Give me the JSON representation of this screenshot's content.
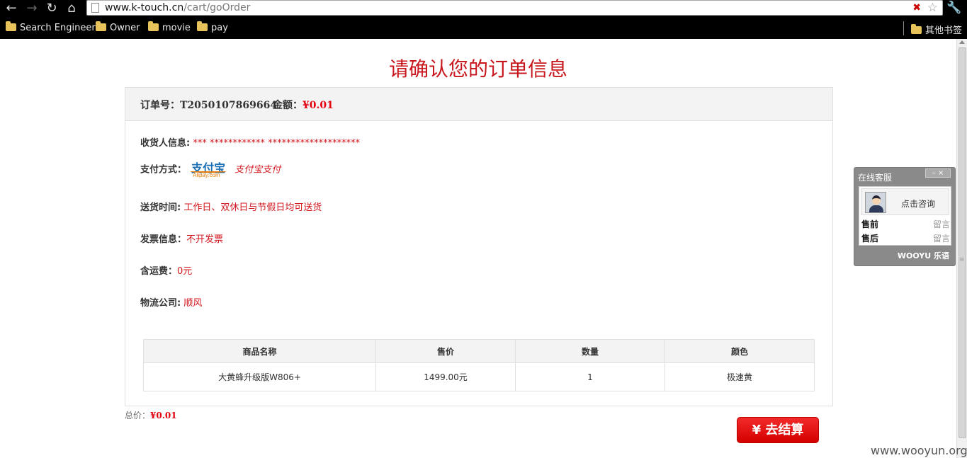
{
  "browser": {
    "url_host": "www.k-touch.cn",
    "url_path": "/cart/goOrder",
    "bookmarks": [
      "Search Engineer",
      "Owner",
      "movie",
      "pay"
    ],
    "other_bookmarks": "其他书签"
  },
  "page": {
    "title": "请确认您的订单信息",
    "order_no_label": "订单号：",
    "order_no": "T2050107869664",
    "amount_label": "金额：",
    "amount": "¥0.01",
    "consignee_label": "收货人信息:",
    "consignee_value": "*** ************ ********************",
    "payment_label": "支付方式：",
    "alipay_logo_cn": "支付宝",
    "alipay_logo_en": "Alipay.com",
    "payment_value": "支付宝支付",
    "delivery_label": "送货时间:",
    "delivery_value": "工作日、双休日与节假日均可送货",
    "invoice_label": "发票信息：",
    "invoice_value": "不开发票",
    "shipping_label": "含运费：",
    "shipping_value": "0元",
    "logistics_label": "物流公司:",
    "logistics_value": "顺风",
    "table": {
      "headers": [
        "商品名称",
        "售价",
        "数量",
        "颜色"
      ],
      "rows": [
        [
          "大黄蜂升级版W806+",
          "1499.00元",
          "1",
          "极速黄"
        ]
      ]
    },
    "total_label": "总价：",
    "total_value": "¥0.01",
    "checkout_label": "¥ 去结算"
  },
  "chat": {
    "title": "在线客服",
    "controls": "–  ×",
    "consult": "点击咨询",
    "presale": "售前",
    "aftersale": "售后",
    "message": "留言",
    "brand": "WOOYU 乐语"
  },
  "watermark": "www.wooyun.org"
}
